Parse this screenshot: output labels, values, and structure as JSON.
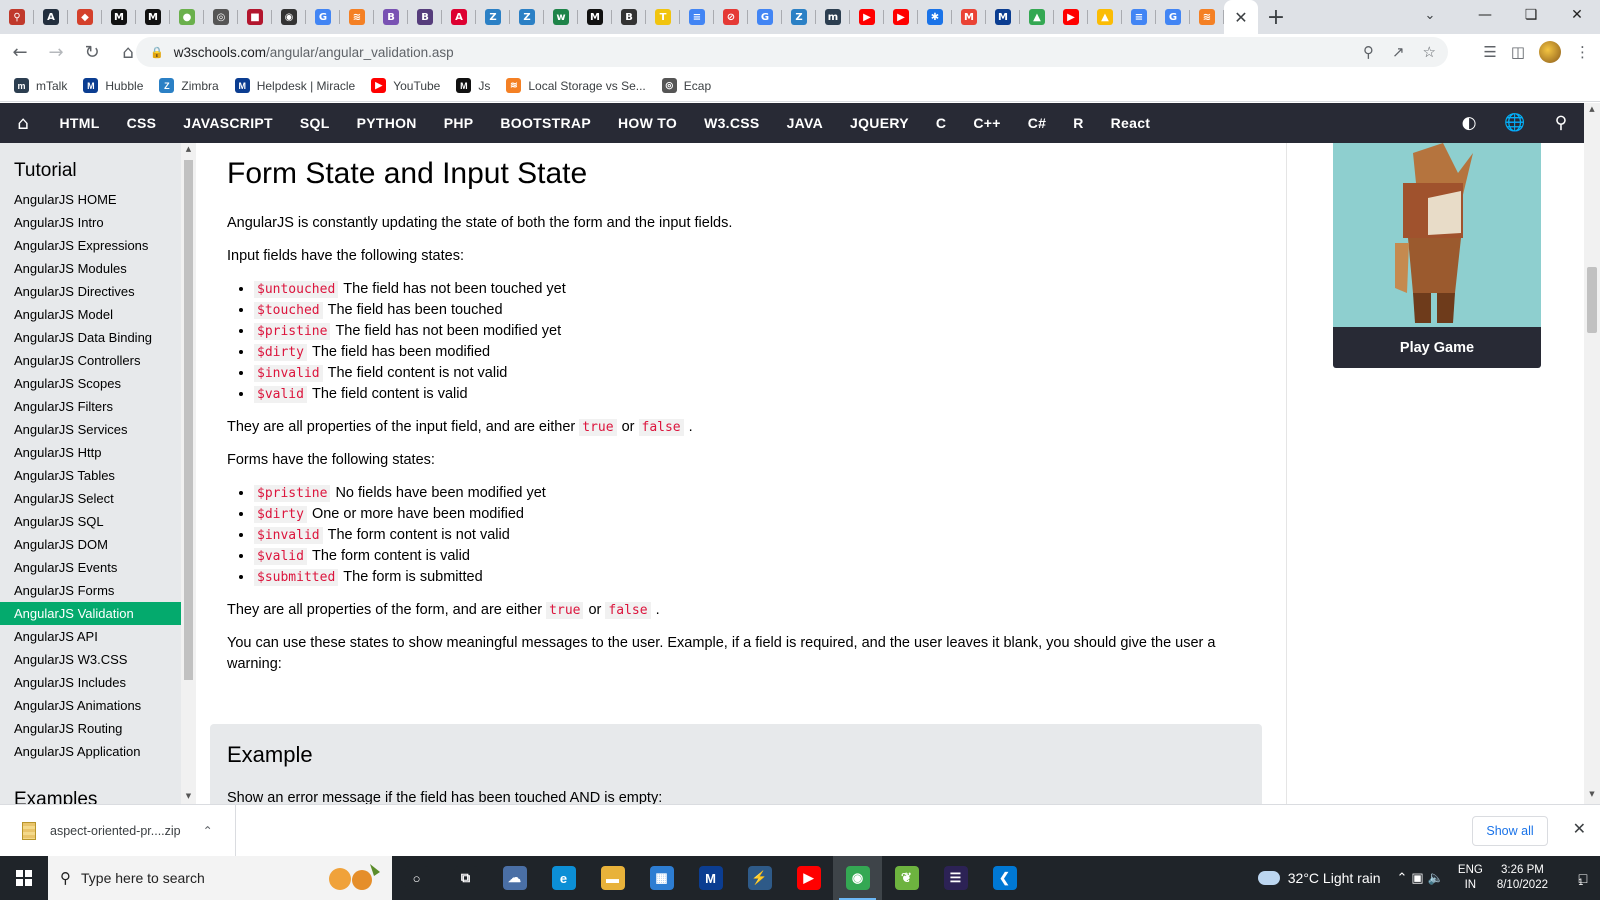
{
  "browser": {
    "tab_favicons": [
      {
        "icon": "pin-icon",
        "color": "#c0392b",
        "glyph": "⚲"
      },
      {
        "icon": "aws-icon",
        "color": "#232f3e",
        "glyph": "A"
      },
      {
        "icon": "shield-icon",
        "color": "#d4402b",
        "glyph": "◆"
      },
      {
        "icon": "medium-icon",
        "color": "#111111",
        "glyph": "M"
      },
      {
        "icon": "medium-icon",
        "color": "#111111",
        "glyph": "M"
      },
      {
        "icon": "leaf-icon",
        "color": "#6ab04c",
        "glyph": "●"
      },
      {
        "icon": "globe-icon",
        "color": "#555555",
        "glyph": "◎"
      },
      {
        "icon": "bookmark-icon",
        "color": "#b3162e",
        "glyph": "■"
      },
      {
        "icon": "github-icon",
        "color": "#333333",
        "glyph": "◉"
      },
      {
        "icon": "google-icon",
        "color": "#4285f4",
        "glyph": "G"
      },
      {
        "icon": "stack-icon",
        "color": "#f48024",
        "glyph": "≋"
      },
      {
        "icon": "bootstrap-icon",
        "color": "#7952b3",
        "glyph": "B"
      },
      {
        "icon": "bootstrap-icon",
        "color": "#563d7c",
        "glyph": "B"
      },
      {
        "icon": "angular-icon",
        "color": "#dd0031",
        "glyph": "A"
      },
      {
        "icon": "zimbra-icon",
        "color": "#2b80c5",
        "glyph": "Z"
      },
      {
        "icon": "zimbra-icon",
        "color": "#2b80c5",
        "glyph": "Z"
      },
      {
        "icon": "w-icon",
        "color": "#1e8449",
        "glyph": "w"
      },
      {
        "icon": "medium-icon",
        "color": "#111111",
        "glyph": "M"
      },
      {
        "icon": "bootstrap-icon",
        "color": "#333333",
        "glyph": "B"
      },
      {
        "icon": "tek-icon",
        "color": "#f1c40f",
        "glyph": "T"
      },
      {
        "icon": "docs-icon",
        "color": "#4285f4",
        "glyph": "≡"
      },
      {
        "icon": "block-icon",
        "color": "#e53935",
        "glyph": "⊘"
      },
      {
        "icon": "google-icon",
        "color": "#4285f4",
        "glyph": "G"
      },
      {
        "icon": "zimbra-icon",
        "color": "#2b80c5",
        "glyph": "Z"
      },
      {
        "icon": "mtalk-icon",
        "color": "#2c3e50",
        "glyph": "m"
      },
      {
        "icon": "youtube-icon",
        "color": "#ff0000",
        "glyph": "▶"
      },
      {
        "icon": "youtube-icon",
        "color": "#ff0000",
        "glyph": "▶"
      },
      {
        "icon": "gear-icon",
        "color": "#1a73e8",
        "glyph": "✱"
      },
      {
        "icon": "gmail-icon",
        "color": "#ea4335",
        "glyph": "M"
      },
      {
        "icon": "miracle-icon",
        "color": "#0b3d91",
        "glyph": "M"
      },
      {
        "icon": "drive-icon",
        "color": "#34a853",
        "glyph": "▲"
      },
      {
        "icon": "youtube-icon",
        "color": "#ff0000",
        "glyph": "▶"
      },
      {
        "icon": "drive-icon",
        "color": "#fbbc04",
        "glyph": "▲"
      },
      {
        "icon": "docs-icon",
        "color": "#4285f4",
        "glyph": "≡"
      },
      {
        "icon": "google-icon",
        "color": "#4285f4",
        "glyph": "G"
      },
      {
        "icon": "stack-icon",
        "color": "#f48024",
        "glyph": "≋"
      }
    ],
    "url_host": "w3schools.com",
    "url_path": "/angular/angular_validation.asp",
    "bookmarks": [
      {
        "label": "mTalk",
        "icon": "mtalk-icon",
        "color": "#2c3e50",
        "glyph": "m"
      },
      {
        "label": "Hubble",
        "icon": "hubble-icon",
        "color": "#0b3d91",
        "glyph": "M"
      },
      {
        "label": "Zimbra",
        "icon": "zimbra-icon",
        "color": "#2b80c5",
        "glyph": "Z"
      },
      {
        "label": "Helpdesk | Miracle",
        "icon": "miracle-icon",
        "color": "#0b3d91",
        "glyph": "M"
      },
      {
        "label": "YouTube",
        "icon": "youtube-icon",
        "color": "#ff0000",
        "glyph": "▶"
      },
      {
        "label": "Js",
        "icon": "medium-icon",
        "color": "#111111",
        "glyph": "M"
      },
      {
        "label": "Local Storage vs Se...",
        "icon": "stack-icon",
        "color": "#f48024",
        "glyph": "≋"
      },
      {
        "label": "Ecap",
        "icon": "globe-icon",
        "color": "#555555",
        "glyph": "◎"
      }
    ]
  },
  "topnav": {
    "links": [
      "HTML",
      "CSS",
      "JAVASCRIPT",
      "SQL",
      "PYTHON",
      "PHP",
      "BOOTSTRAP",
      "HOW TO",
      "W3.CSS",
      "JAVA",
      "JQUERY",
      "C",
      "C++",
      "C#",
      "R",
      "React"
    ]
  },
  "sidebar": {
    "heading": "Tutorial",
    "items": [
      "AngularJS HOME",
      "AngularJS Intro",
      "AngularJS Expressions",
      "AngularJS Modules",
      "AngularJS Directives",
      "AngularJS Model",
      "AngularJS Data Binding",
      "AngularJS Controllers",
      "AngularJS Scopes",
      "AngularJS Filters",
      "AngularJS Services",
      "AngularJS Http",
      "AngularJS Tables",
      "AngularJS Select",
      "AngularJS SQL",
      "AngularJS DOM",
      "AngularJS Events",
      "AngularJS Forms",
      "AngularJS Validation",
      "AngularJS API",
      "AngularJS W3.CSS",
      "AngularJS Includes",
      "AngularJS Animations",
      "AngularJS Routing",
      "AngularJS Application"
    ],
    "active_item": "AngularJS Validation",
    "examples_heading": "Examples"
  },
  "main": {
    "title": "Form State and Input State",
    "intro": "AngularJS is constantly updating the state of both the form and the input fields.",
    "input_heading": "Input fields have the following states:",
    "input_states": [
      {
        "code": "$untouched",
        "text": "The field has not been touched yet"
      },
      {
        "code": "$touched",
        "text": "The field has been touched"
      },
      {
        "code": "$pristine",
        "text": "The field has not been modified yet"
      },
      {
        "code": "$dirty",
        "text": "The field has been modified"
      },
      {
        "code": "$invalid",
        "text": "The field content is not valid"
      },
      {
        "code": "$valid",
        "text": "The field content is valid"
      }
    ],
    "input_props_pre": "They are all properties of the input field, and are either",
    "true_code": "true",
    "or_word": "or",
    "false_code": "false",
    "period": ".",
    "form_heading": "Forms have the following states:",
    "form_states": [
      {
        "code": "$pristine",
        "text": "No fields have been modified yet"
      },
      {
        "code": "$dirty",
        "text": "One or more have been modified"
      },
      {
        "code": "$invalid",
        "text": "The form content is not valid"
      },
      {
        "code": "$valid",
        "text": "The form content is valid"
      },
      {
        "code": "$submitted",
        "text": "The form is submitted"
      }
    ],
    "form_props_pre": "They are all properties of the form, and are either",
    "usage": "You can use these states to show meaningful messages to the user. Example, if a field is required, and the user leaves it blank, you should give the user a warning:",
    "example_title": "Example",
    "example_desc": "Show an error message if the field has been touched AND is empty:"
  },
  "ad": {
    "button_label": "Play Game"
  },
  "downloads": {
    "file_name": "aspect-oriented-pr....zip",
    "show_all": "Show all"
  },
  "taskbar": {
    "search_placeholder": "Type here to search",
    "apps": [
      {
        "icon": "cortana-icon",
        "color": "#1f2429",
        "glyph": "○"
      },
      {
        "icon": "task-view-icon",
        "color": "#1f2429",
        "glyph": "⧉"
      },
      {
        "icon": "weather-app-icon",
        "color": "#4a6fa5",
        "glyph": "☁"
      },
      {
        "icon": "edge-icon",
        "color": "#0c8fd6",
        "glyph": "e"
      },
      {
        "icon": "file-explorer-icon",
        "color": "#e8b23a",
        "glyph": "▬"
      },
      {
        "icon": "store-icon",
        "color": "#2d7dd2",
        "glyph": "▦"
      },
      {
        "icon": "miracle-icon",
        "color": "#0b3d91",
        "glyph": "M"
      },
      {
        "icon": "network-app-icon",
        "color": "#2e5a88",
        "glyph": "⚡"
      },
      {
        "icon": "youtube-icon",
        "color": "#ff0000",
        "glyph": "▶"
      },
      {
        "icon": "chrome-icon",
        "color": "#34a853",
        "glyph": "◉"
      },
      {
        "icon": "spring-icon",
        "color": "#6db33f",
        "glyph": "❦"
      },
      {
        "icon": "eclipse-icon",
        "color": "#2c2255",
        "glyph": "☰"
      },
      {
        "icon": "vscode-icon",
        "color": "#0078d4",
        "glyph": "❮"
      }
    ],
    "active_app_index": 9,
    "weather": "32°C  Light rain",
    "lang_top": "ENG",
    "lang_bottom": "IN",
    "time": "3:26 PM",
    "date": "8/10/2022",
    "notification_count": "1"
  }
}
